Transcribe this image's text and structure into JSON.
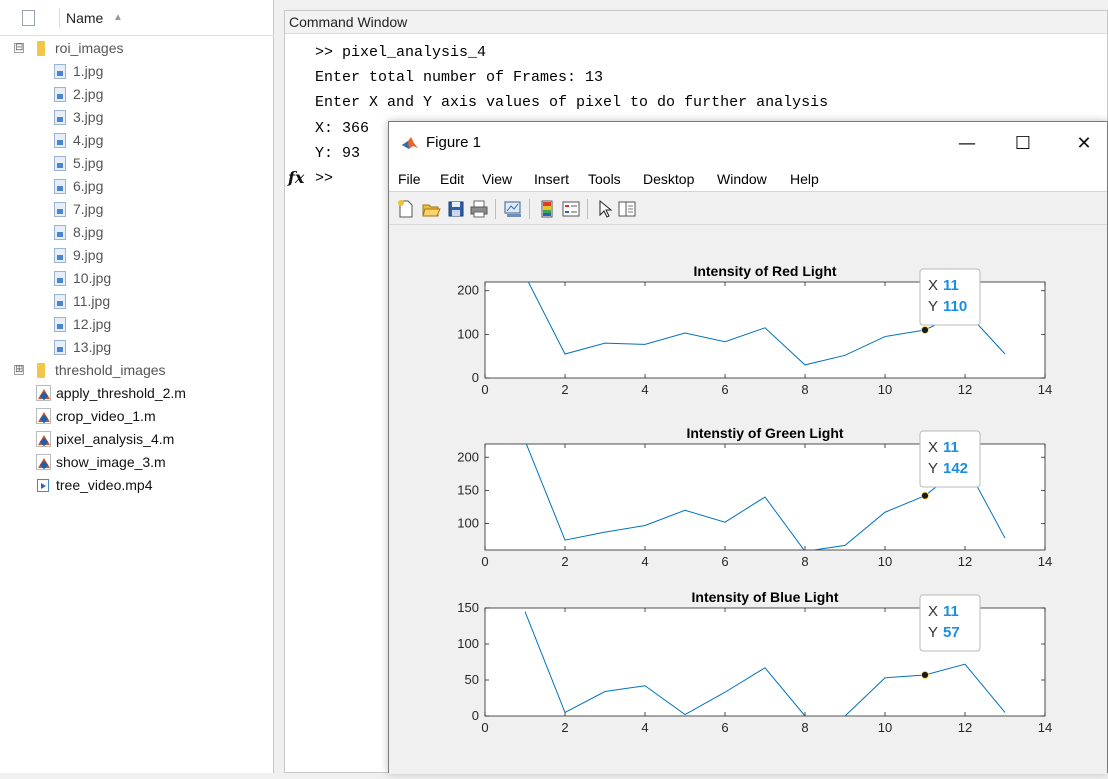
{
  "file_browser": {
    "header_label": "Name",
    "sort_indicator": "▲",
    "items": [
      {
        "label": "roi_images",
        "type": "folder",
        "expander": "⊟",
        "indent": 0
      },
      {
        "label": "1.jpg",
        "type": "image",
        "indent": 1
      },
      {
        "label": "2.jpg",
        "type": "image",
        "indent": 1
      },
      {
        "label": "3.jpg",
        "type": "image",
        "indent": 1
      },
      {
        "label": "4.jpg",
        "type": "image",
        "indent": 1
      },
      {
        "label": "5.jpg",
        "type": "image",
        "indent": 1
      },
      {
        "label": "6.jpg",
        "type": "image",
        "indent": 1
      },
      {
        "label": "7.jpg",
        "type": "image",
        "indent": 1
      },
      {
        "label": "8.jpg",
        "type": "image",
        "indent": 1
      },
      {
        "label": "9.jpg",
        "type": "image",
        "indent": 1
      },
      {
        "label": "10.jpg",
        "type": "image",
        "indent": 1
      },
      {
        "label": "11.jpg",
        "type": "image",
        "indent": 1
      },
      {
        "label": "12.jpg",
        "type": "image",
        "indent": 1
      },
      {
        "label": "13.jpg",
        "type": "image",
        "indent": 1
      },
      {
        "label": "threshold_images",
        "type": "folder",
        "expander": "⊞",
        "indent": 0
      },
      {
        "label": "apply_threshold_2.m",
        "type": "m-file",
        "indent": 0
      },
      {
        "label": "crop_video_1.m",
        "type": "m-file",
        "indent": 0
      },
      {
        "label": "pixel_analysis_4.m",
        "type": "m-file",
        "indent": 0
      },
      {
        "label": "show_image_3.m",
        "type": "m-file",
        "indent": 0
      },
      {
        "label": "tree_video.mp4",
        "type": "video",
        "indent": 0
      }
    ]
  },
  "command_window": {
    "title": "Command Window",
    "lines": [
      ">> pixel_analysis_4",
      "Enter total number of Frames: 13",
      "Enter X and Y axis values of pixel to do further analysis",
      "X: 366",
      "Y: 93",
      ">>"
    ],
    "fx_symbol": "fx"
  },
  "figure_window": {
    "title": "Figure 1",
    "minimize": "—",
    "maximize": "☐",
    "close": "✕",
    "menu": [
      "File",
      "Edit",
      "View",
      "Insert",
      "Tools",
      "Desktop",
      "Window",
      "Help"
    ],
    "toolbar_icons": [
      "new-figure-icon",
      "open-file-icon",
      "save-icon",
      "print-icon",
      "link-plot-icon",
      "colorbar-icon",
      "legend-icon",
      "pointer-icon",
      "property-inspector-icon"
    ]
  },
  "colors": {
    "line": "#0072bd",
    "datatip_value": "#1a8fe0",
    "axis": "#262626",
    "background": "#f0f0f0"
  },
  "chart_data": [
    {
      "type": "line",
      "title": "Intensity of Red Light",
      "x": [
        1,
        2,
        3,
        4,
        5,
        6,
        7,
        8,
        9,
        10,
        11,
        12,
        13
      ],
      "values": [
        235,
        55,
        80,
        77,
        103,
        83,
        115,
        30,
        52,
        95,
        110,
        155,
        55
      ],
      "xlim": [
        0,
        14
      ],
      "ylim": [
        0,
        220
      ],
      "xticks": [
        0,
        2,
        4,
        6,
        8,
        10,
        12,
        14
      ],
      "yticks": [
        0,
        100,
        200
      ],
      "datatip": {
        "x": 11,
        "y": 110,
        "x_label": "X",
        "y_label": "Y"
      }
    },
    {
      "type": "line",
      "title": "Intenstiy of Green Light",
      "x": [
        1,
        2,
        3,
        4,
        5,
        6,
        7,
        8,
        9,
        10,
        11,
        12,
        13
      ],
      "values": [
        225,
        75,
        87,
        97,
        120,
        102,
        140,
        58,
        67,
        117,
        142,
        190,
        78
      ],
      "xlim": [
        0,
        14
      ],
      "ylim": [
        60,
        220
      ],
      "xticks": [
        0,
        2,
        4,
        6,
        8,
        10,
        12,
        14
      ],
      "yticks": [
        100,
        150,
        200
      ],
      "datatip": {
        "x": 11,
        "y": 142,
        "x_label": "X",
        "y_label": "Y"
      }
    },
    {
      "type": "line",
      "title": "Intensity of Blue Light",
      "x": [
        1,
        2,
        3,
        4,
        5,
        6,
        7,
        8,
        9,
        10,
        11,
        12,
        13
      ],
      "values": [
        145,
        5,
        34,
        42,
        2,
        33,
        67,
        0,
        0,
        53,
        57,
        72,
        5
      ],
      "xlim": [
        0,
        14
      ],
      "ylim": [
        0,
        150
      ],
      "xticks": [
        0,
        2,
        4,
        6,
        8,
        10,
        12,
        14
      ],
      "yticks": [
        0,
        50,
        100,
        150
      ],
      "datatip": {
        "x": 11,
        "y": 57,
        "x_label": "X",
        "y_label": "Y"
      }
    }
  ]
}
